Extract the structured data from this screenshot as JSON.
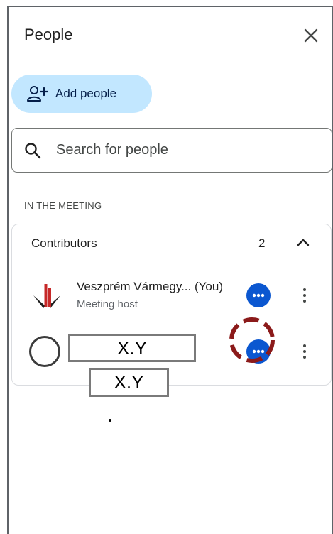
{
  "header": {
    "title": "People",
    "close_icon": "close-icon"
  },
  "actions": {
    "add_people_label": "Add people",
    "add_people_icon": "person-add-icon"
  },
  "search": {
    "placeholder": "Search for people",
    "icon": "search-icon"
  },
  "section": {
    "label": "IN THE MEETING"
  },
  "contributors": {
    "label": "Contributors",
    "count": "2",
    "expanded": true,
    "participants": [
      {
        "name": "Veszprém Vármegy...  (You)",
        "role": "Meeting host"
      },
      {
        "name": "X.Y",
        "role": ""
      }
    ]
  },
  "overlay": {
    "secondary_label": "X.Y",
    "marker": "."
  },
  "colors": {
    "accent": "#0b57d0",
    "add_button_bg": "#c2e7ff",
    "highlight_ring": "#8b1a1a",
    "logo_red": "#c62828"
  }
}
